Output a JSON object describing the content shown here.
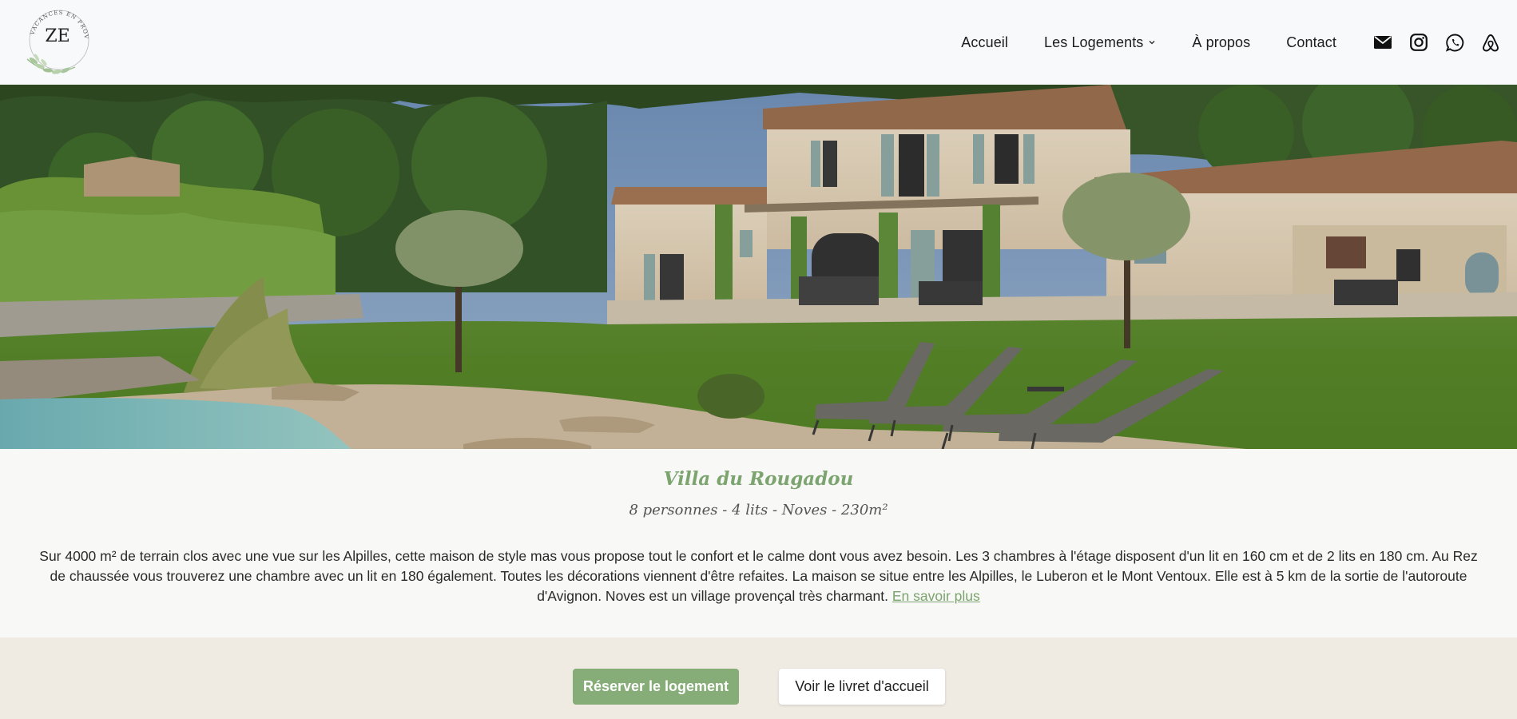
{
  "logo": {
    "monogram": "ZE",
    "arc_text": "VACANCES EN PROVENCE"
  },
  "nav": {
    "items": [
      {
        "label": "Accueil"
      },
      {
        "label": "Les Logements"
      },
      {
        "label": "À propos"
      },
      {
        "label": "Contact"
      }
    ],
    "social_icons": [
      "mail-icon",
      "instagram-icon",
      "whatsapp-icon",
      "airbnb-icon"
    ]
  },
  "listing": {
    "title": "Villa du Rougadou",
    "subtitle": "8 personnes - 4 lits - Noves - 230m²",
    "description": "Sur 4000 m² de terrain clos avec une vue sur les Alpilles, cette maison de style mas vous propose tout le confort et le calme dont vous avez besoin. Les 3 chambres à l'étage disposent d'un lit en 160 cm et de 2 lits en 180 cm. Au Rez de chaussée vous trouverez une chambre avec un lit en 180 également. Toutes les décorations viennent d'être refaites. La maison se situe entre les Alpilles, le Luberon et le Mont Ventoux. Elle est à 5 km de la sortie de l'autoroute d'Avignon. Noves est un village provençal très charmant.",
    "more_link": "En savoir plus"
  },
  "actions": {
    "book": "Réserver le logement",
    "guide": "Voir le livret d'accueil"
  },
  "colors": {
    "accent": "#86ad78",
    "band": "#efebe2",
    "title_green": "#7ba46e"
  }
}
